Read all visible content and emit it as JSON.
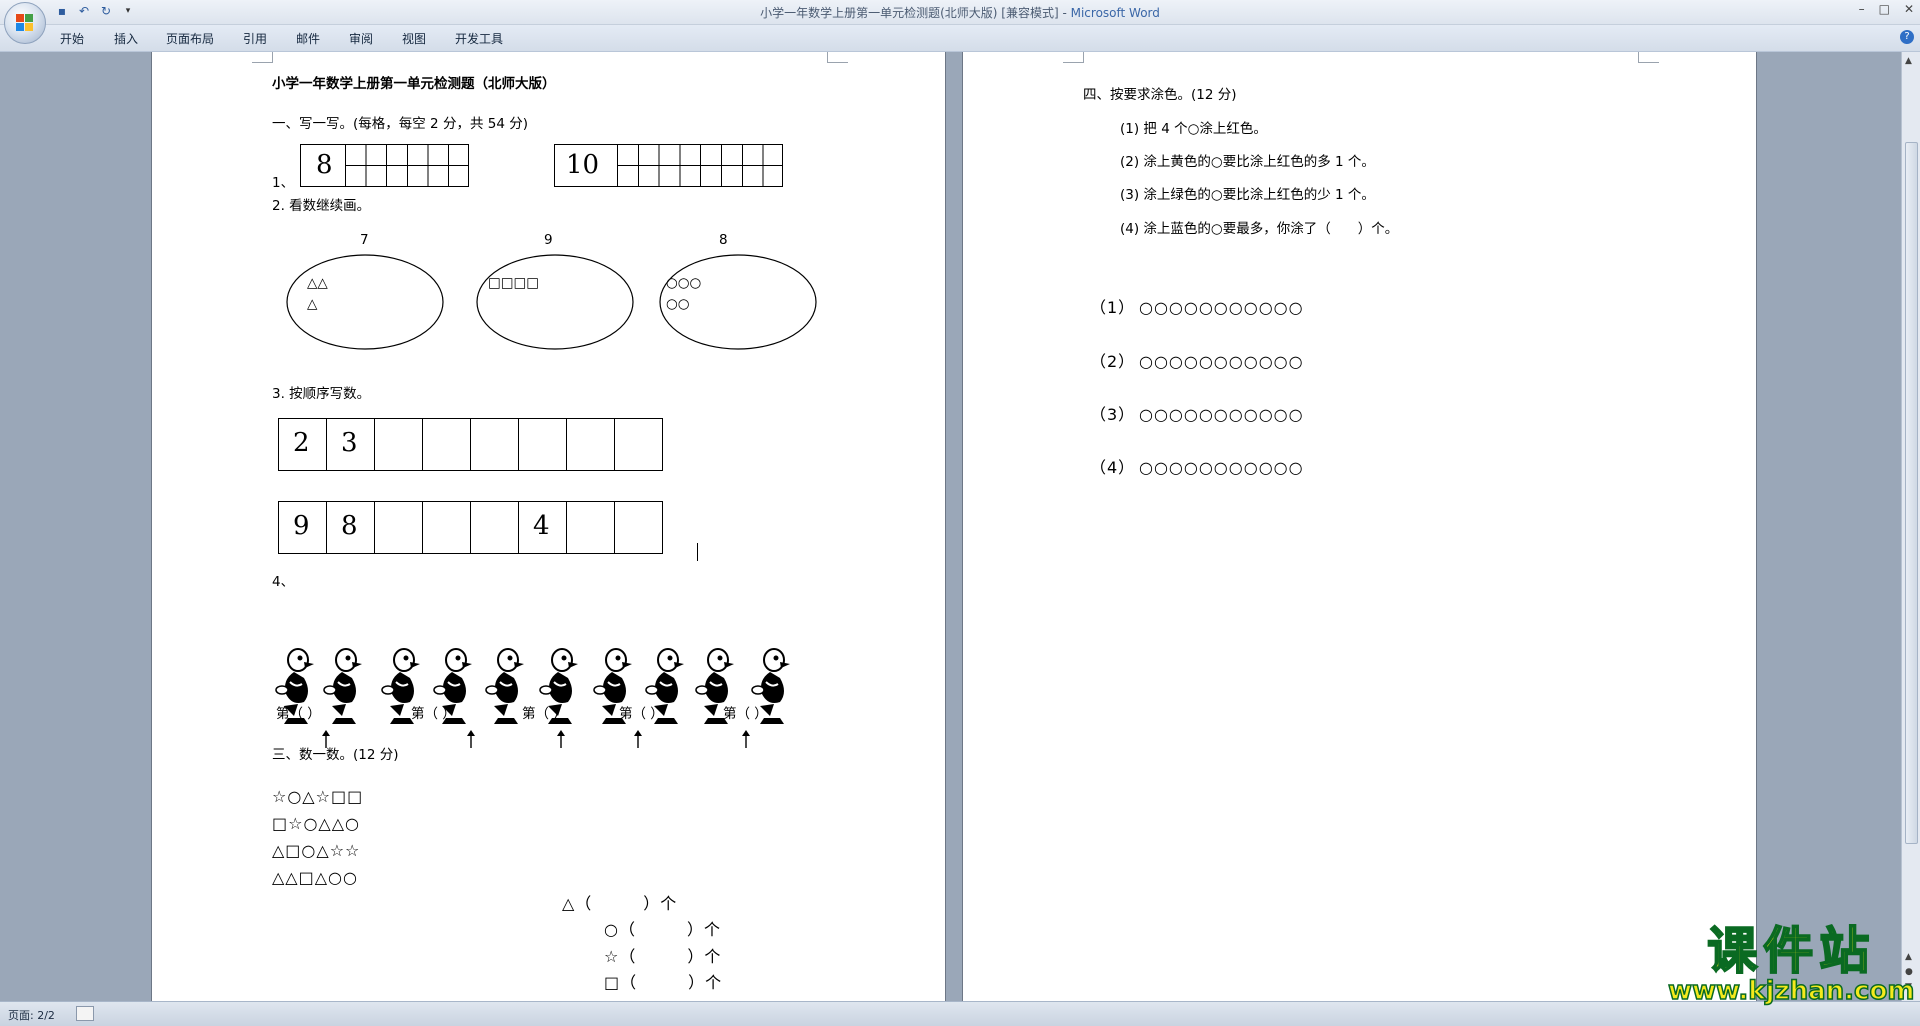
{
  "window": {
    "title": "小学一年数学上册第一单元检测题(北师大版) [兼容模式] - ",
    "app_name": "Microsoft Word"
  },
  "ribbon_tabs": [
    "开始",
    "插入",
    "页面布局",
    "引用",
    "邮件",
    "审阅",
    "视图",
    "开发工具"
  ],
  "status": {
    "page_label": "页面: 2/2"
  },
  "page1": {
    "title": "小学一年数学上册第一单元检测题（北师大版）",
    "section1": "一、写一写。(每格，每空 2 分，共 54 分)",
    "q1_label": "1、",
    "q1_box_a": "8",
    "q1_box_b": "10",
    "q2_label": "2. 看数继续画。",
    "q2_numbers": [
      "7",
      "9",
      "8"
    ],
    "q2_oval1_row1": "△△",
    "q2_oval1_row2": "△",
    "q2_oval2_row1": "□□□□",
    "q2_oval3_row1": "○○○",
    "q2_oval3_row2": "○○",
    "q3_label": "3. 按顺序写数。",
    "q3_row1": [
      "2",
      "3",
      "",
      "",
      "",
      "",
      "",
      ""
    ],
    "q3_row2": [
      "9",
      "8",
      "",
      "",
      "",
      "4",
      "",
      ""
    ],
    "q4_label": "4、",
    "q4_blanks": [
      "第（ ）",
      "第（ ）",
      "第（ ）",
      "第（ ）",
      "第（ ）"
    ],
    "section3": "三、数一数。(12 分)",
    "q5_rows": [
      "☆○△☆□□",
      "□☆○△△○",
      "△□○△☆☆",
      "△△□△○○"
    ],
    "q5_answers": [
      "△（　　　）个",
      "○（　　　）个",
      "☆（　　　）个",
      "□（　　　）个"
    ]
  },
  "page2": {
    "section4": "四、按要求涂色。(12 分)",
    "instructions": [
      "(1) 把 4 个○涂上红色。",
      "(2) 涂上黄色的○要比涂上红色的多 1 个。",
      "(3) 涂上绿色的○要比涂上红色的少 1 个。",
      "(4) 涂上蓝色的○要最多，你涂了（　　）个。"
    ],
    "circle_rows": [
      {
        "label": "（1）",
        "circles": "○○○○○○○○○○○"
      },
      {
        "label": "（2）",
        "circles": "○○○○○○○○○○○"
      },
      {
        "label": "（3）",
        "circles": "○○○○○○○○○○○"
      },
      {
        "label": "（4）",
        "circles": "○○○○○○○○○○○"
      }
    ]
  },
  "watermark": {
    "line1": "课件站",
    "line2": "www.kjzhan.com"
  },
  "colors": {
    "accent": "#3a66a7",
    "watermark_fill": "#f4ea1c",
    "watermark_stroke": "#0a6a22"
  }
}
